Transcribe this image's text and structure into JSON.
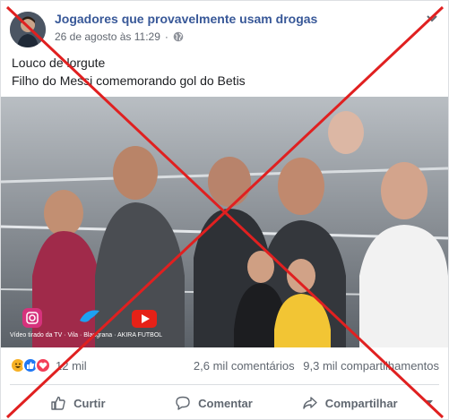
{
  "post": {
    "page_name": "Jogadores que provavelmente usam drogas",
    "date": "26 de agosto às 11:29",
    "separator": "·",
    "text_line1": "Louco de lorgute",
    "text_line2": "Filho do Messi comemorando gol do Betis"
  },
  "video": {
    "watermark_line": "Vídeo tirado da TV · Vila · Blaugrana · AKIRA FUTBOL"
  },
  "stats": {
    "reaction_count": "12 mil",
    "comments": "2,6 mil comentários",
    "shares": "9,3 mil compartilhamentos"
  },
  "actions": {
    "like": "Curtir",
    "comment": "Comentar",
    "share": "Compartilhar"
  },
  "colors": {
    "page_name": "#385898",
    "overlay_x": "#e02020"
  }
}
